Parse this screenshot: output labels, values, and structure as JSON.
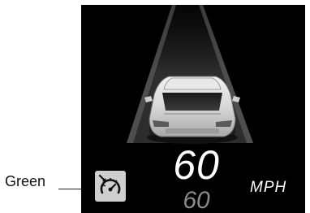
{
  "callout": {
    "label": "Green"
  },
  "cluster": {
    "current_speed": "60",
    "set_speed": "60",
    "unit": "MPH"
  },
  "icons": {
    "cruise_control": "adaptive-cruise-control-icon",
    "vehicle": "lead-vehicle-icon"
  },
  "colors": {
    "display_background": "#000000",
    "icon_background": "#cfcfcf",
    "set_speed": "#8a8a8a"
  }
}
